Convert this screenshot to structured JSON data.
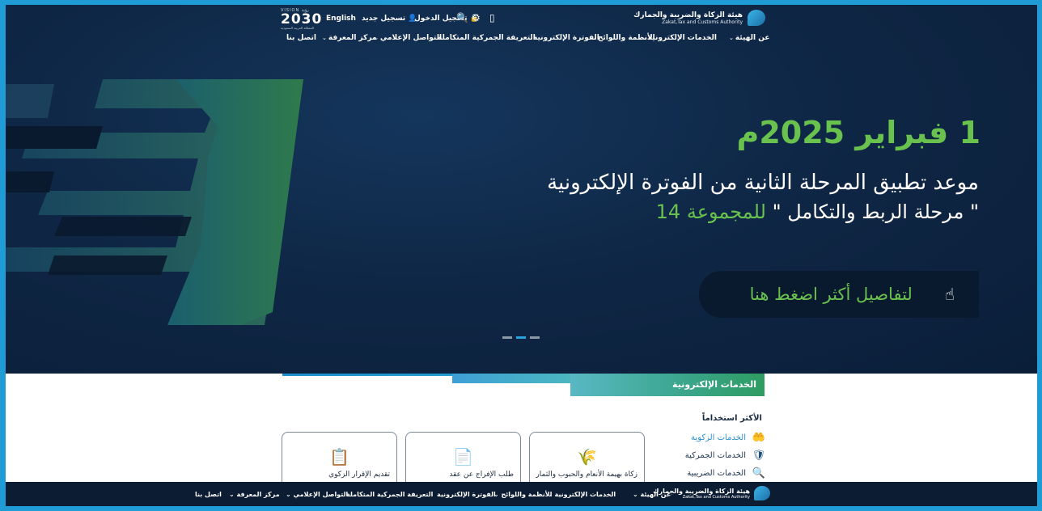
{
  "header": {
    "logo_ar": "هيئة الزكاة والضريبة والجمارك",
    "logo_en": "Zakat,Tax and Customs Authority",
    "vision_small": "VISION رؤية",
    "vision_big": "2030",
    "vision_tag": "المملكة العربية السعودية",
    "language": "English",
    "register": "تسجيل جديد",
    "login": "تسجيل الدخول",
    "icons": [
      "search-icon",
      "sitemap-icon",
      "mobile-icon"
    ]
  },
  "nav": {
    "items": [
      {
        "label": "عن الهيئة",
        "dropdown": true
      },
      {
        "label": "الخدمات الإلكترونية",
        "dropdown": true
      },
      {
        "label": "الأنظمة واللوائح",
        "dropdown": true
      },
      {
        "label": "الفوترة الإلكترونية",
        "dropdown": false
      },
      {
        "label": "التعريفة الجمركية المتكاملة",
        "dropdown": false
      },
      {
        "label": "التواصل الإعلامي",
        "dropdown": true
      },
      {
        "label": "مركز المعرفة",
        "dropdown": true
      },
      {
        "label": "اتصل بنا",
        "dropdown": false
      }
    ]
  },
  "hero": {
    "date": "1 فبراير 2025م",
    "line1": "موعد تطبيق المرحلة الثانية من الفوترة الإلكترونية",
    "line2_white": "\" مرحلة الربط والتكامل \"",
    "line2_green": "للمجموعة 14",
    "cta": "لتفاصيل أكثر اضغط هنا",
    "slides": 3,
    "active_slide": 2
  },
  "services": {
    "title": "الخدمات الإلكترونية",
    "most_used": "الأكثر استخداماً",
    "list": [
      {
        "label": "الخدمات الزكوية",
        "icon": "zakat-icon",
        "active": true
      },
      {
        "label": "الخدمات الجمركية",
        "icon": "shield-icon",
        "active": false
      },
      {
        "label": "الخدمات الضريبية",
        "icon": "tax-search-icon",
        "active": false
      }
    ],
    "cards": [
      {
        "label": "زكاة بهيمة الأنعام والحبوب والثمار",
        "icon": "crops-icon"
      },
      {
        "label": "طلب الإفراج عن عقد",
        "icon": "contract-icon"
      },
      {
        "label": "تقديم الإقرار الزكوي",
        "icon": "declaration-icon"
      }
    ]
  },
  "colors": {
    "accent_green": "#6ac24e",
    "accent_blue": "#29a3dc",
    "navy": "#0e2440"
  }
}
